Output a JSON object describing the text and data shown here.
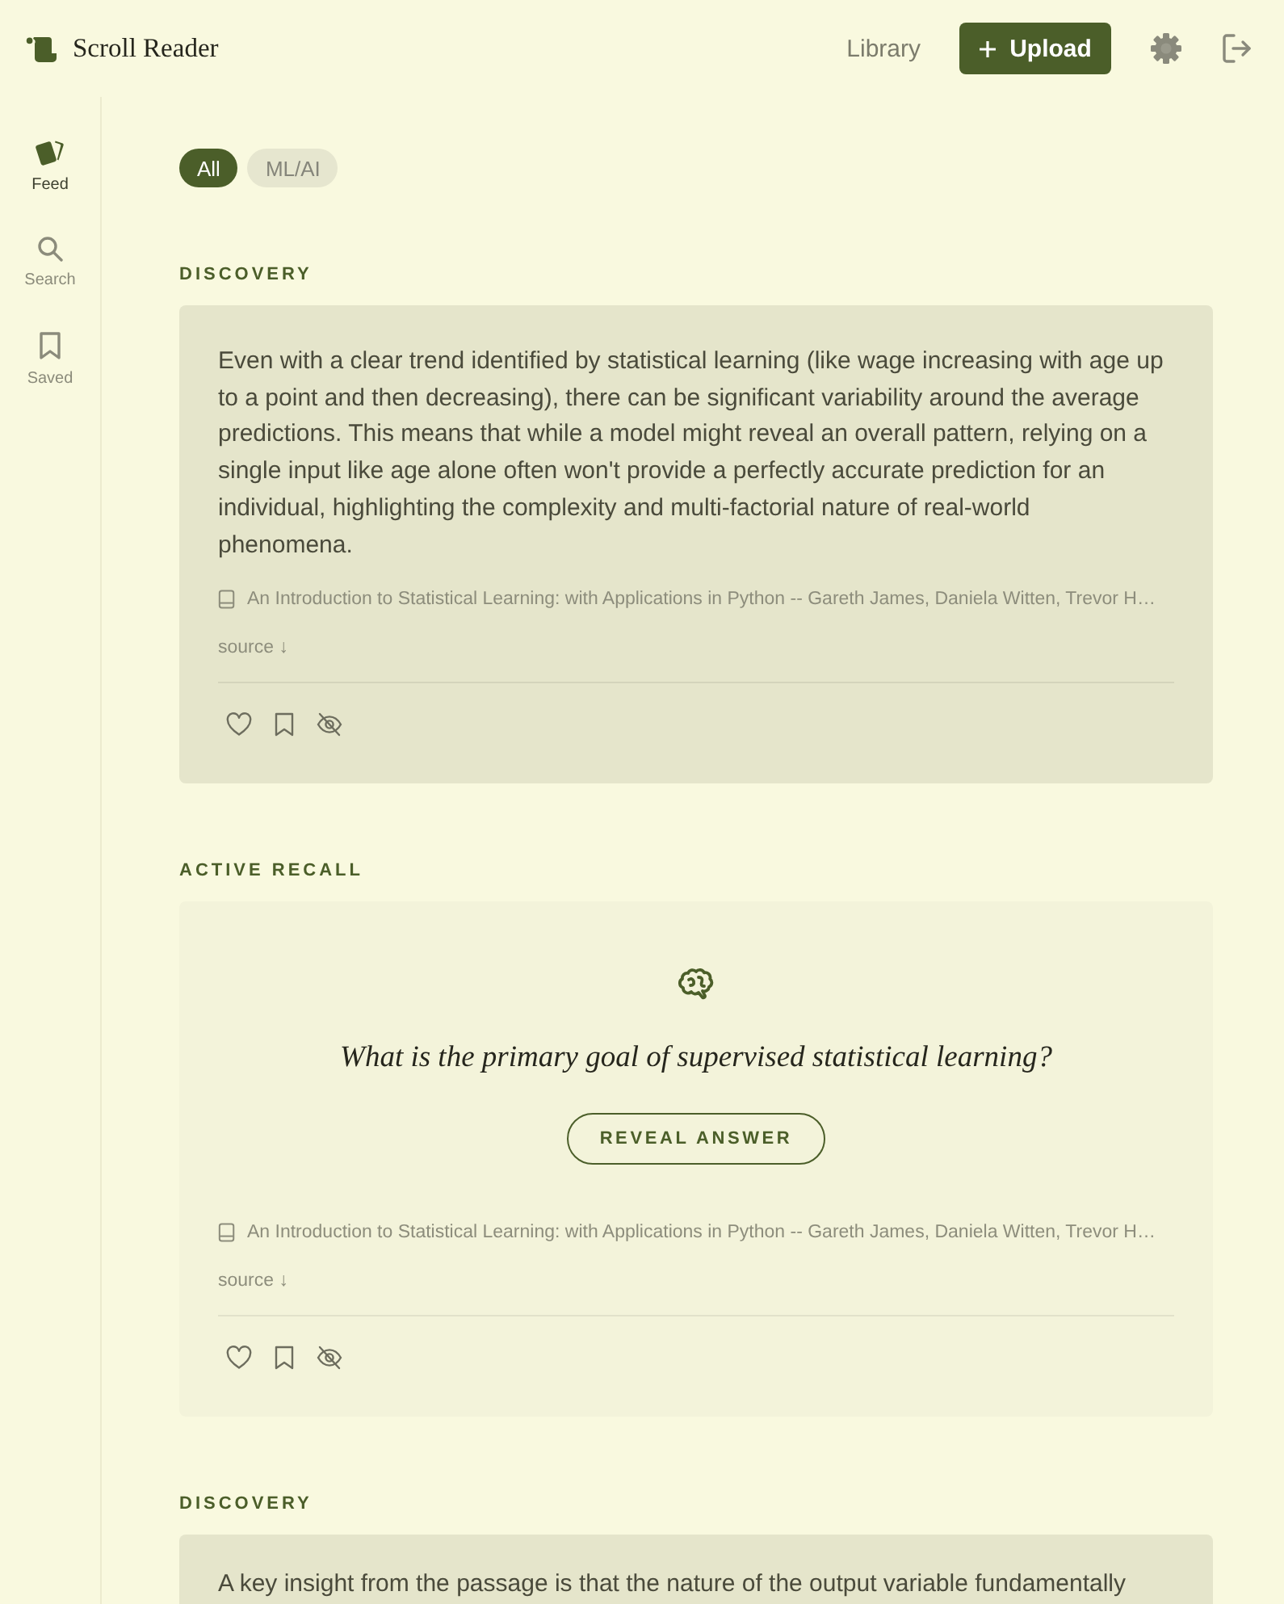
{
  "header": {
    "title": "Scroll Reader",
    "nav_link": "Library",
    "upload_button": "Upload"
  },
  "sidebar": {
    "items": [
      {
        "kind": "feed",
        "label": "Feed",
        "selected": true
      },
      {
        "kind": "search",
        "label": "Search",
        "selected": false
      },
      {
        "kind": "saved",
        "label": "Saved",
        "selected": false
      }
    ]
  },
  "filters": [
    {
      "label": "All",
      "selected": true
    },
    {
      "label": "ML/AI",
      "selected": false
    }
  ],
  "feed": [
    {
      "kind": "discovery",
      "label": "DISCOVERY",
      "text": "Even with a clear trend identified by statistical learning (like wage increasing with age up to a point and then decreasing), there can be significant variability around the average predictions. This means that while a model might reveal an overall pattern, relying on a single input like age alone often won't provide a perfectly accurate prediction for an individual, highlighting the complexity and multi-factorial nature of real-world phenomena.",
      "source": "An Introduction to Statistical Learning: with Applications in Python -- Gareth James, Daniela Witten, Trevor H…",
      "source_toggle": "source ↓"
    },
    {
      "kind": "recall",
      "label": "ACTIVE RECALL",
      "question": "What is the primary goal of supervised statistical learning?",
      "button": "REVEAL ANSWER",
      "source": "An Introduction to Statistical Learning: with Applications in Python -- Gareth James, Daniela Witten, Trevor H…",
      "source_toggle": "source ↓"
    },
    {
      "kind": "discovery",
      "label": "DISCOVERY",
      "text": "A key insight from the passage is that the nature of the output variable fundamentally"
    }
  ]
}
